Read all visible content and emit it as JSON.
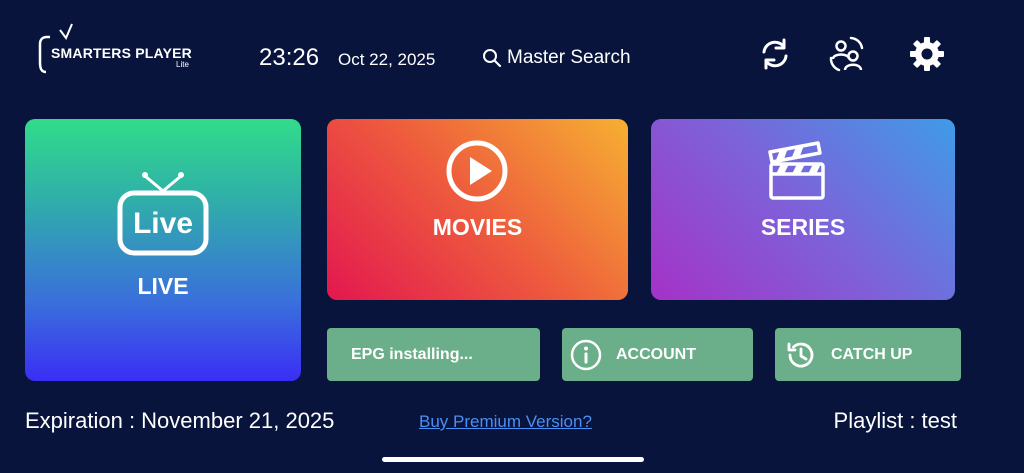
{
  "header": {
    "logo_title": "SMARTERS PLAYER",
    "logo_subtitle": "Lite",
    "time": "23:26",
    "date": "Oct 22, 2025",
    "search_label": "Master Search",
    "icons": [
      "refresh-icon",
      "switch-user-icon",
      "gear-icon"
    ]
  },
  "tiles": {
    "live": {
      "label": "LIVE",
      "icon_text": "Live"
    },
    "movies": {
      "label": "MOVIES"
    },
    "series": {
      "label": "SERIES"
    }
  },
  "buttons": {
    "epg": {
      "label": "EPG installing..."
    },
    "account": {
      "label": "ACCOUNT"
    },
    "catch_up": {
      "label": "CATCH UP"
    }
  },
  "footer": {
    "expiration": "Expiration : November 21, 2025",
    "premium_link": "Buy Premium Version?",
    "playlist": "Playlist : test"
  },
  "colors": {
    "background": "#08143c",
    "button_green": "#6aaf89",
    "link_blue": "#4a8ff5"
  }
}
